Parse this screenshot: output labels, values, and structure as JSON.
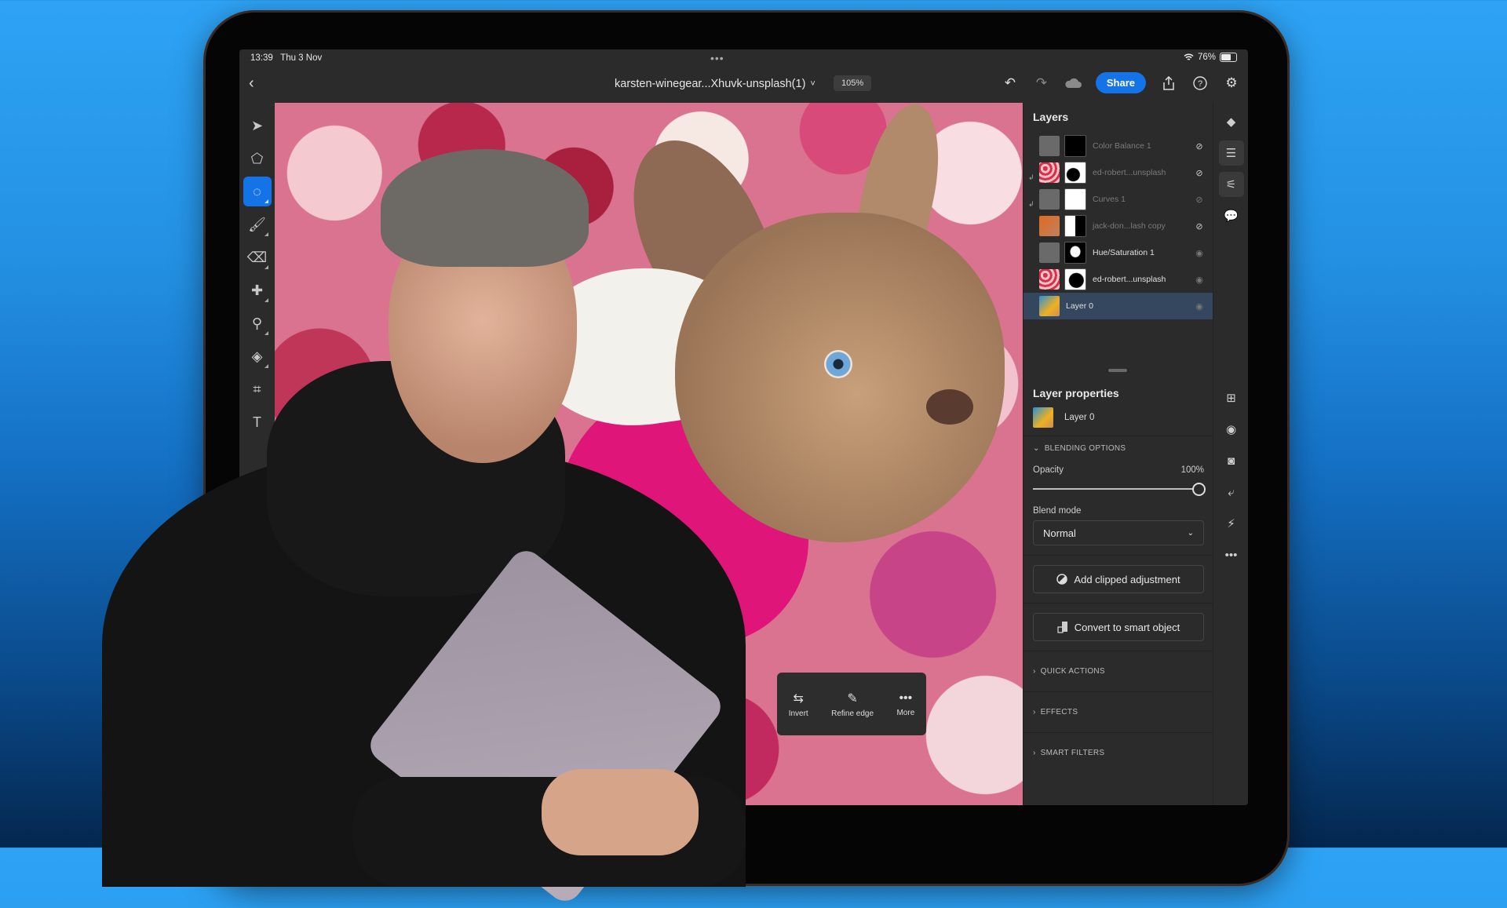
{
  "status_bar": {
    "time": "13:39",
    "date": "Thu 3 Nov",
    "multitask_dots": "•••",
    "wifi_icon": "wifi-icon",
    "battery_percent": "76%",
    "battery_level": 0.76
  },
  "app_bar": {
    "back_icon": "chevron-left-icon",
    "document_title": "karsten-winegear...Xhuvk-unsplash(1)",
    "title_chevron": "˅",
    "zoom_level": "105%",
    "undo_icon": "undo-icon",
    "redo_icon": "redo-icon",
    "cloud_icon": "cloud-icon",
    "share_label": "Share",
    "export_icon": "export-icon",
    "help_icon": "help-icon",
    "settings_icon": "gear-icon"
  },
  "tools": [
    {
      "name": "select",
      "glyph": "➤",
      "active": false
    },
    {
      "name": "transform",
      "glyph": "⬠",
      "active": false
    },
    {
      "name": "lasso",
      "glyph": "◌",
      "active": true
    },
    {
      "name": "brush",
      "glyph": "🖌",
      "active": false
    },
    {
      "name": "eraser",
      "glyph": "⌫",
      "active": false
    },
    {
      "name": "healing",
      "glyph": "✚",
      "active": false
    },
    {
      "name": "clone",
      "glyph": "⚲",
      "active": false
    },
    {
      "name": "fill",
      "glyph": "◈",
      "active": false
    },
    {
      "name": "crop",
      "glyph": "⌗",
      "active": false
    },
    {
      "name": "type",
      "glyph": "T",
      "active": false
    }
  ],
  "floating_toolbar": {
    "items": [
      {
        "label": "Invert",
        "icon": "invert-icon",
        "glyph": "⇆"
      },
      {
        "label": "Refine edge",
        "icon": "refine-edge-icon",
        "glyph": "✎"
      },
      {
        "label": "More",
        "icon": "more-icon",
        "glyph": "•••"
      }
    ]
  },
  "layers_panel": {
    "title": "Layers",
    "layers": [
      {
        "name": "Color Balance 1",
        "visible": false,
        "clipped": false,
        "selected": false
      },
      {
        "name": "ed-robert...unsplash",
        "visible": false,
        "clipped": true,
        "selected": false
      },
      {
        "name": "Curves 1",
        "visible": false,
        "clipped": true,
        "selected": false
      },
      {
        "name": "jack-don...lash copy",
        "visible": false,
        "clipped": false,
        "selected": false
      },
      {
        "name": "Hue/Saturation 1",
        "visible": true,
        "clipped": false,
        "selected": false
      },
      {
        "name": "ed-robert...unsplash",
        "visible": true,
        "clipped": false,
        "selected": false
      },
      {
        "name": "Layer 0",
        "visible": true,
        "clipped": false,
        "selected": true
      }
    ]
  },
  "layer_properties": {
    "title": "Layer properties",
    "current_layer": "Layer 0",
    "blending_options_label": "BLENDING OPTIONS",
    "opacity_label": "Opacity",
    "opacity_value": "100%",
    "opacity_fraction": 1.0,
    "blend_mode_label": "Blend mode",
    "blend_mode_value": "Normal",
    "add_clipped_adjustment_label": "Add clipped adjustment",
    "convert_smart_object_label": "Convert to smart object",
    "quick_actions_label": "QUICK ACTIONS",
    "effects_label": "EFFECTS",
    "smart_filters_label": "SMART FILTERS"
  },
  "right_rail": [
    {
      "name": "layers-icon",
      "glyph": "◆",
      "on": false
    },
    {
      "name": "layer-properties-icon",
      "glyph": "☰",
      "on": true
    },
    {
      "name": "adjustments-icon",
      "glyph": "⚟",
      "on": true
    },
    {
      "name": "comments-icon",
      "glyph": "💬",
      "on": false
    },
    {
      "name": "add-layer-icon",
      "glyph": "⊞",
      "on": false
    },
    {
      "name": "visibility-icon",
      "glyph": "◉",
      "on": false
    },
    {
      "name": "mask-icon",
      "glyph": "◙",
      "on": false
    },
    {
      "name": "clip-icon",
      "glyph": "⤶",
      "on": false
    },
    {
      "name": "fx-icon",
      "glyph": "⚡",
      "on": false
    },
    {
      "name": "more-options-icon",
      "glyph": "•••",
      "on": false
    }
  ],
  "colors": {
    "accent": "#1473e6",
    "panel_bg": "#2b2b2b",
    "selected_row": "#34475e",
    "background_top": "#2ea3f5",
    "background_bottom": "#04274f"
  }
}
